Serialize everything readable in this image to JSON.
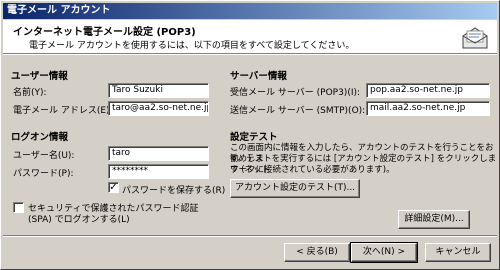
{
  "window": {
    "title": "電子メール アカウント"
  },
  "header": {
    "title": "インターネット電子メール設定 (POP3)",
    "description": "電子メール アカウントを使用するには、以下の項目をすべて設定してください。",
    "icon": "mail-envelope-icon"
  },
  "user_info": {
    "heading": "ユーザー情報",
    "name_label": "名前(Y):",
    "name_value": "Taro Suzuki",
    "email_label": "電子メール アドレス(E):",
    "email_value": "taro@aa2.so-net.ne.jp"
  },
  "server_info": {
    "heading": "サーバー情報",
    "incoming_label": "受信メール サーバー (POP3)(I):",
    "incoming_value": "pop.aa2.so-net.ne.jp",
    "outgoing_label": "送信メール サーバー (SMTP)(O):",
    "outgoing_value": "mail.aa2.so-net.ne.jp"
  },
  "login_info": {
    "heading": "ログオン情報",
    "username_label": "ユーザー名(U):",
    "username_value": "taro",
    "password_label": "パスワード(P):",
    "password_value": "********",
    "remember_label": "パスワードを保存する(R)",
    "remember_checked": true,
    "spa_label_line1": "セキュリティで保護されたパスワード認証",
    "spa_label_line2": "(SPA) でログオンする(L)",
    "spa_checked": false
  },
  "test": {
    "heading": "設定テスト",
    "text_line1": "この画面内に情報を入力したら、アカウントのテストを行うことをお勧めしま",
    "text_line2": "す。テストを実行するには [アカウント設定のテスト] をクリックします (ネット",
    "text_line3": "ワークに接続されている必要があります)。",
    "button_label": "アカウント設定のテスト(T)..."
  },
  "buttons": {
    "advanced": "詳細設定(M)...",
    "back": "< 戻る(B)",
    "next": "次へ(N) >",
    "cancel": "キャンセル"
  }
}
